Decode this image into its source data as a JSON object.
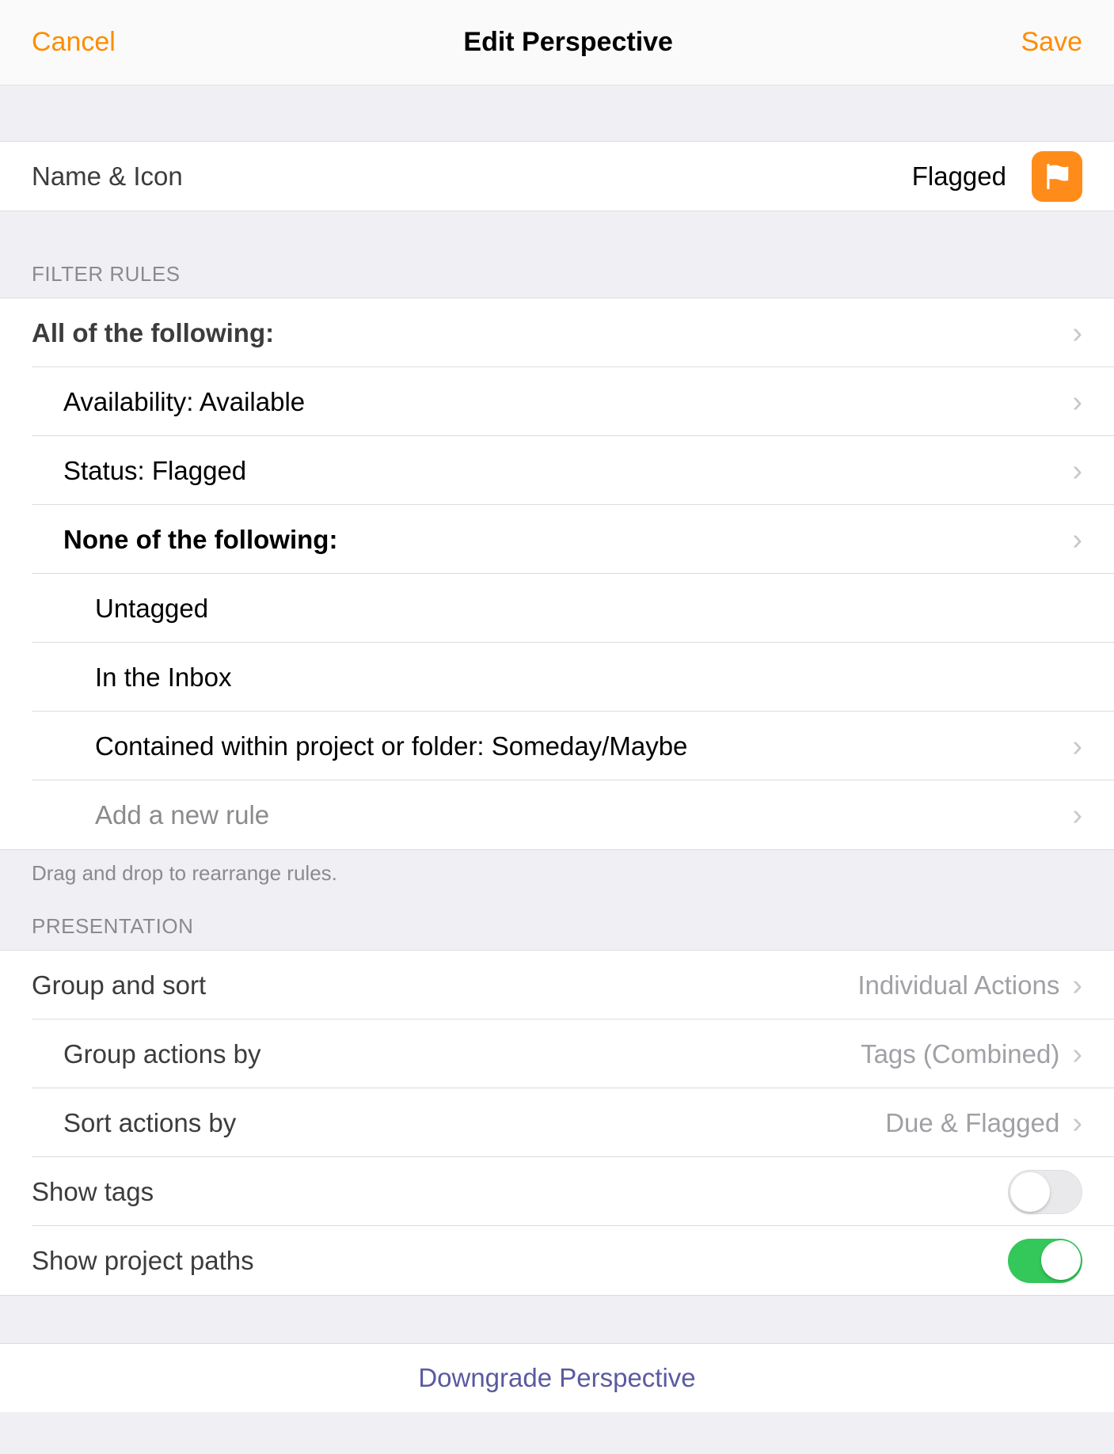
{
  "header": {
    "cancel": "Cancel",
    "title": "Edit Perspective",
    "save": "Save"
  },
  "name_row": {
    "label": "Name & Icon",
    "value": "Flagged",
    "icon": "flag-icon"
  },
  "filter_section": {
    "header": "Filter Rules",
    "footer": "Drag and drop to rearrange rules.",
    "rules": {
      "root_label": "All of the following:",
      "availability": "Availability: Available",
      "status": "Status: Flagged",
      "none_label": "None of the following:",
      "untagged": "Untagged",
      "in_inbox": "In the Inbox",
      "contained": "Contained within project or folder: Someday/Maybe",
      "add_new": "Add a new rule"
    }
  },
  "presentation_section": {
    "header": "Presentation",
    "group_sort": {
      "label": "Group and sort",
      "value": "Individual Actions"
    },
    "group_by": {
      "label": "Group actions by",
      "value": "Tags (Combined)"
    },
    "sort_by": {
      "label": "Sort actions by",
      "value": "Due & Flagged"
    },
    "show_tags": {
      "label": "Show tags",
      "value": false
    },
    "show_paths": {
      "label": "Show project paths",
      "value": true
    }
  },
  "downgrade": "Downgrade Perspective"
}
